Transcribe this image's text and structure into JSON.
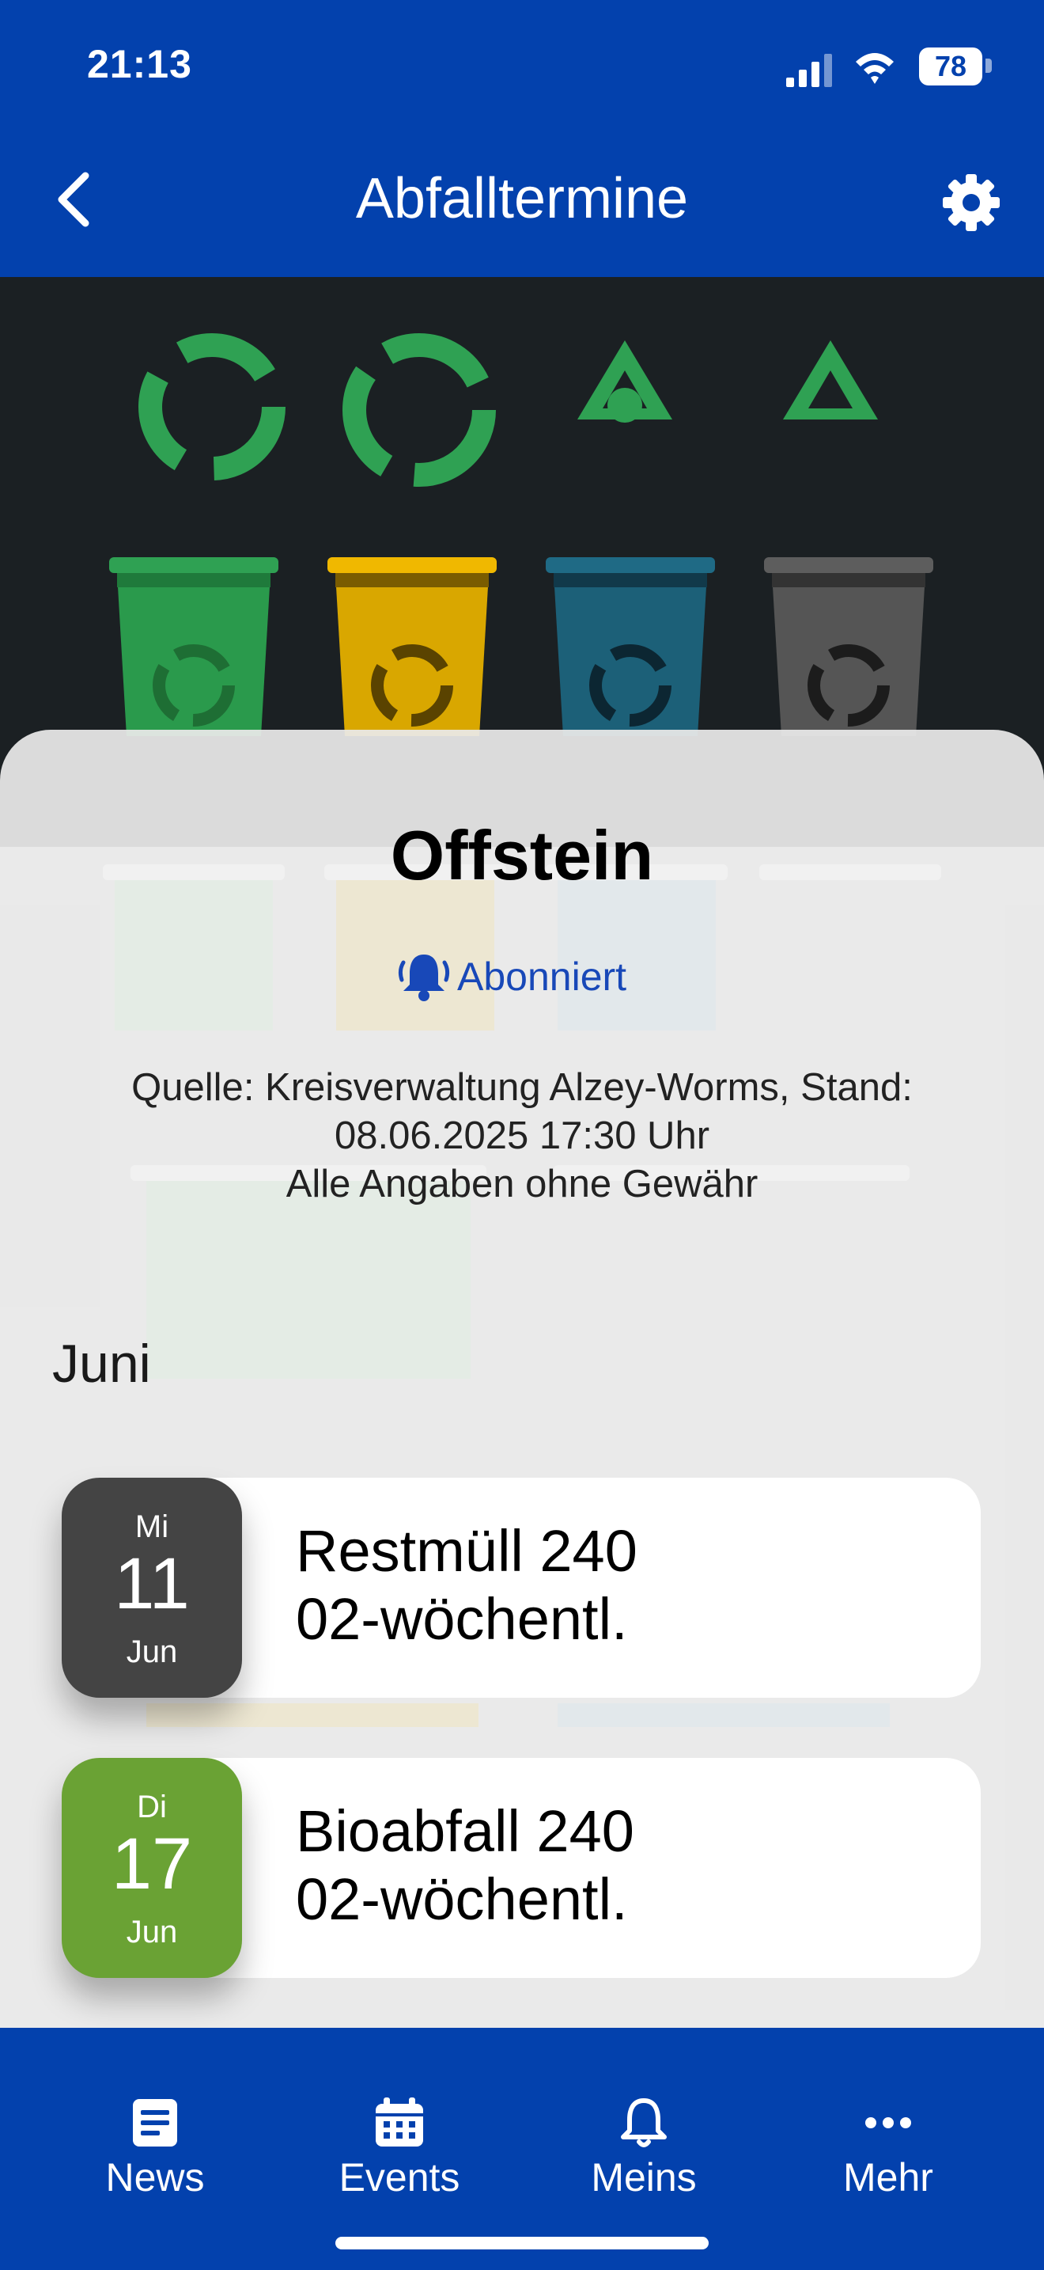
{
  "status_bar": {
    "time": "21:13",
    "battery": "78"
  },
  "header": {
    "title": "Abfalltermine"
  },
  "location": {
    "name": "Offstein",
    "subscription_label": "Abonniert",
    "source_line1": "Quelle: Kreisverwaltung Alzey-Worms, Stand:",
    "source_line2": "08.06.2025 17:30 Uhr",
    "disclaimer": "Alle Angaben ohne Gewähr"
  },
  "month": "Juni",
  "events": [
    {
      "weekday": "Mi",
      "day": "11",
      "month": "Jun",
      "line1": "Restmüll 240",
      "line2": "02-wöchentl.",
      "color": "#444444"
    },
    {
      "weekday": "Di",
      "day": "17",
      "month": "Jun",
      "line1": "Bioabfall 240",
      "line2": "02-wöchentl.",
      "color": "#6aa234"
    }
  ],
  "tabs": [
    {
      "label": "News",
      "icon": "news-icon"
    },
    {
      "label": "Events",
      "icon": "calendar-icon"
    },
    {
      "label": "Meins",
      "icon": "bell-icon"
    },
    {
      "label": "Mehr",
      "icon": "more-icon"
    }
  ],
  "colors": {
    "brand": "#0341ad",
    "link": "#1848b8"
  }
}
